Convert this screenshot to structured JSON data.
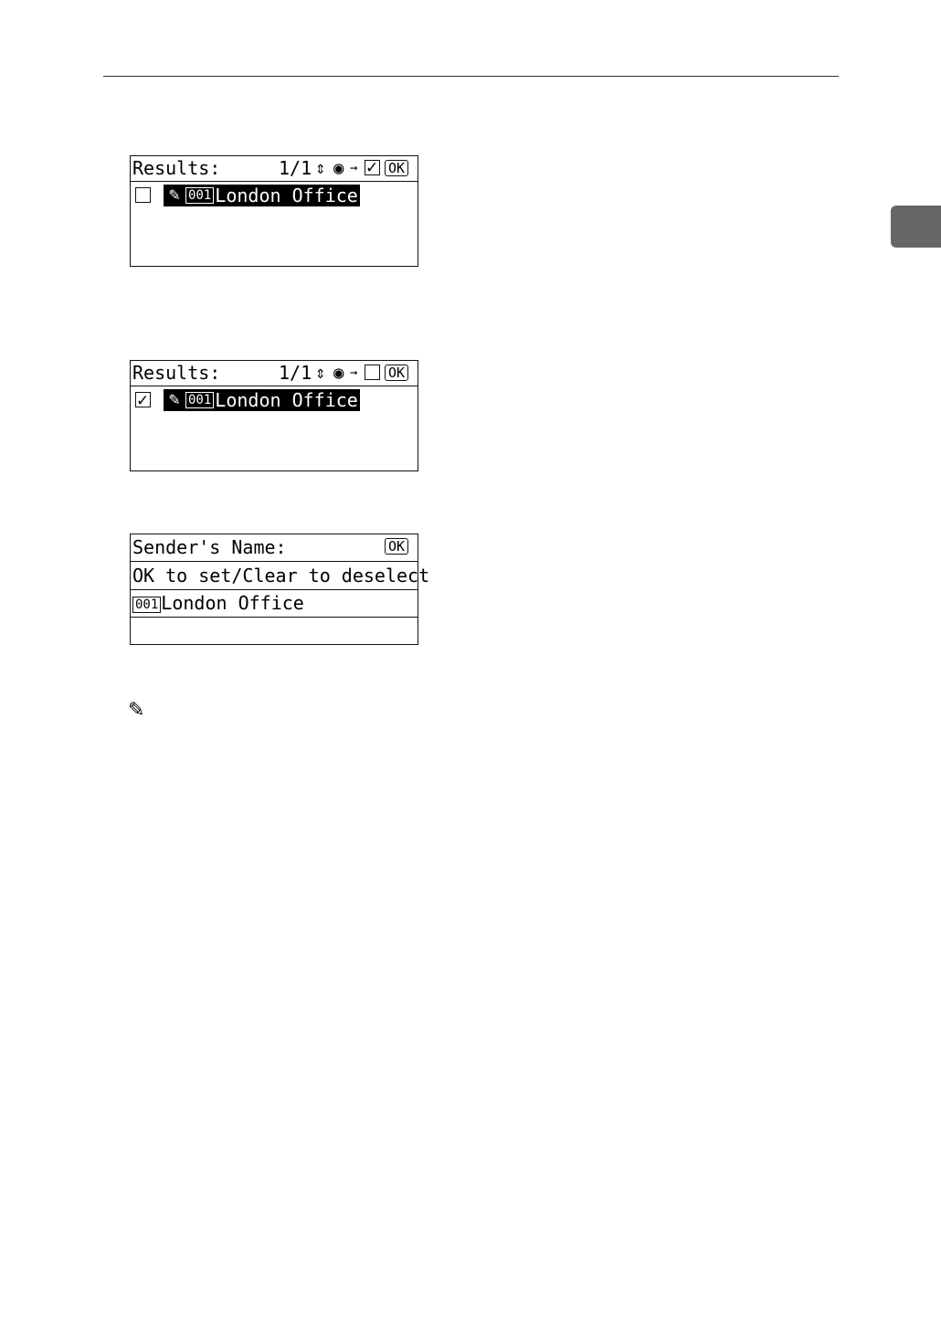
{
  "screen1": {
    "title": "Results:",
    "page": "1/1",
    "nav_icons": [
      "up-down-arrows-icon",
      "right-arrow-circle-icon",
      "arrow-icon",
      "checked-box-icon"
    ],
    "ok_label": "OK",
    "row": {
      "checked": false,
      "number": "001",
      "name": "London Office"
    }
  },
  "screen2": {
    "title": "Results:",
    "page": "1/1",
    "nav_icons": [
      "up-down-arrows-icon",
      "left-arrow-circle-icon",
      "arrow-icon",
      "empty-box-icon"
    ],
    "ok_label": "OK",
    "row": {
      "checked": true,
      "number": "001",
      "name": "London Office"
    }
  },
  "screen3": {
    "title": "Sender's Name:",
    "ok_label": "OK",
    "message": "OK to set/Clear to deselect",
    "row": {
      "number": "001",
      "name": "London Office"
    }
  }
}
